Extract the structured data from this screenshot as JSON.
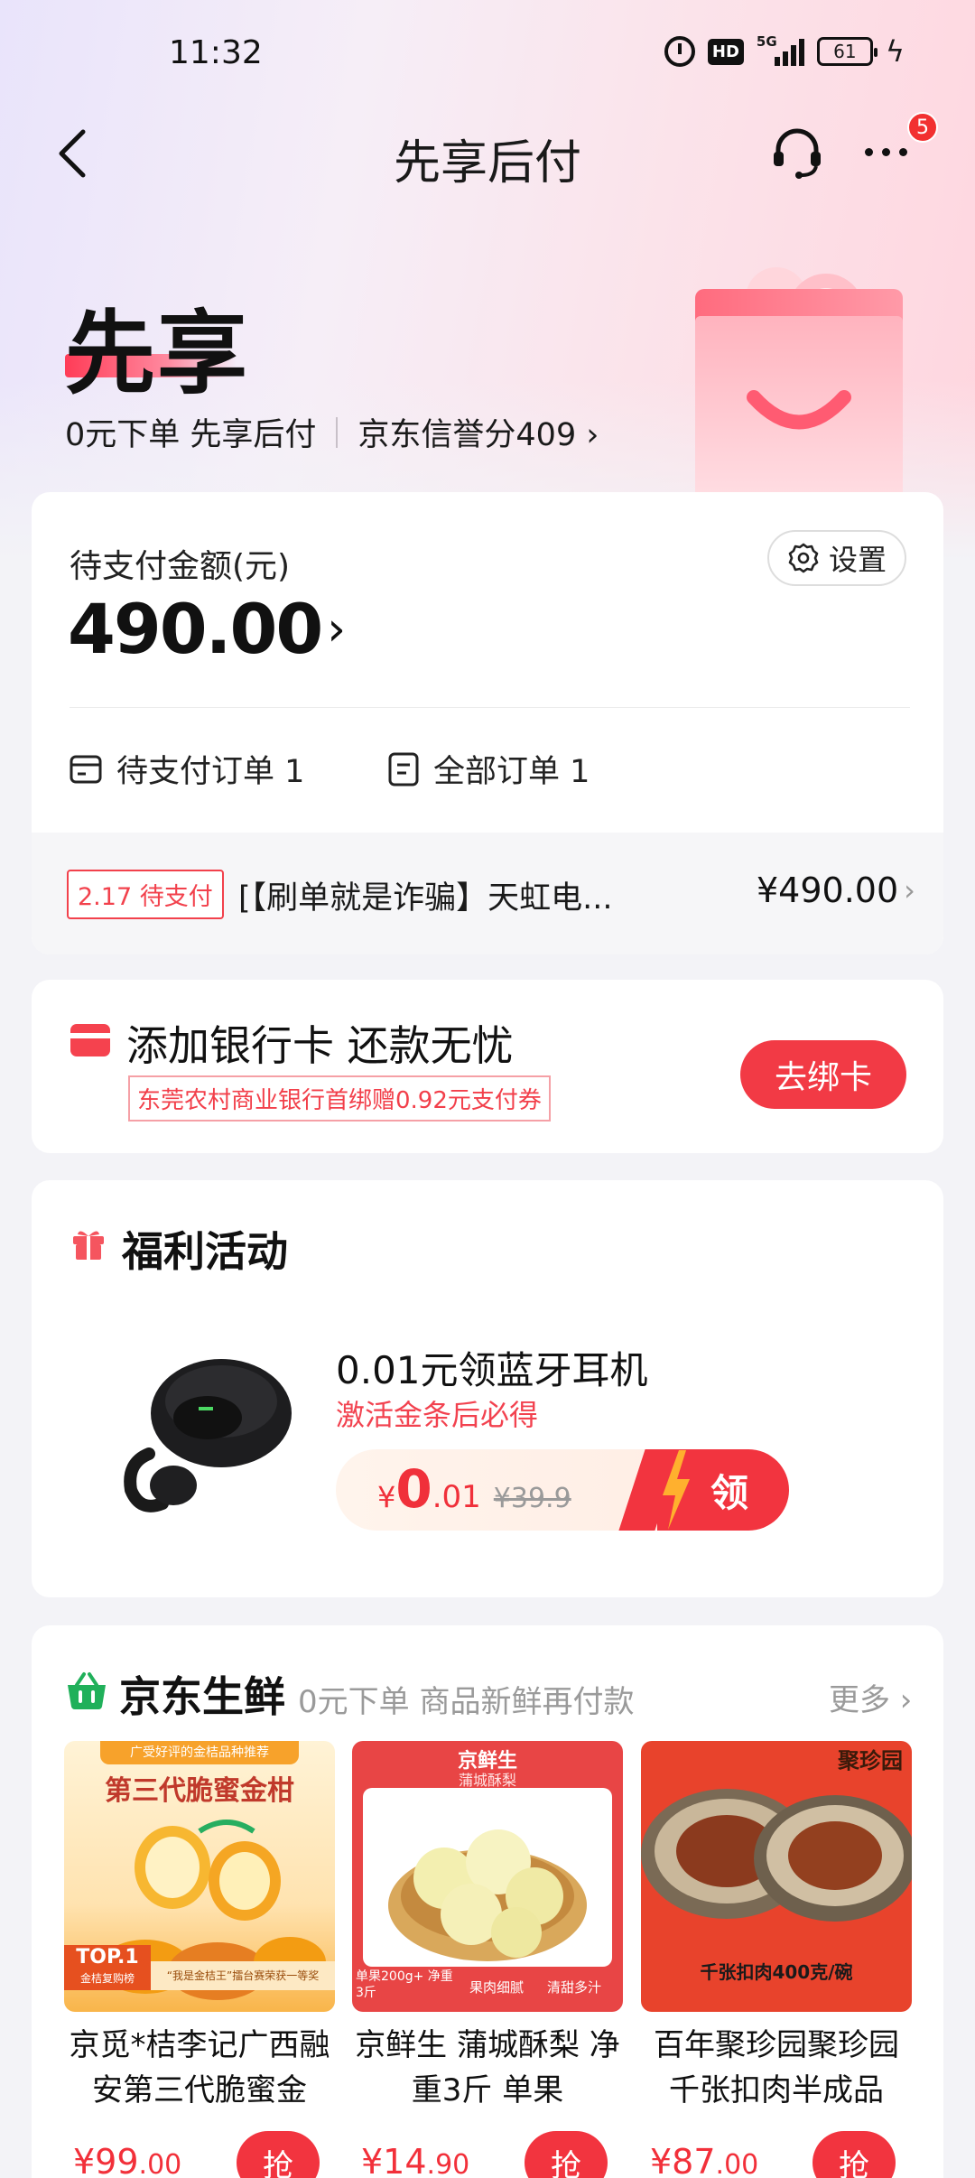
{
  "status_bar": {
    "time": "11:32",
    "hd": "HD",
    "network": "5G",
    "battery": "61"
  },
  "nav": {
    "title": "先享后付",
    "badge": "5"
  },
  "hero": {
    "title": "先享",
    "subtitle": "0元下单 先享后付",
    "credit": "京东信誉分409 ›"
  },
  "pending": {
    "label": "待支付金额(元)",
    "amount": "490.00",
    "settings_label": "设置",
    "pending_orders": "待支付订单 1",
    "all_orders": "全部订单 1",
    "order": {
      "tag": "2.17 待支付",
      "title": "[【刷单就是诈骗】天虹电...",
      "price": "¥490.00"
    }
  },
  "bank": {
    "title": "添加银行卡 还款无忧",
    "coupon": "东莞农村商业银行首绑赠0.92元支付券",
    "button": "去绑卡"
  },
  "welfare": {
    "title": "福利活动",
    "item_name": "0.01元领蓝牙耳机",
    "item_desc": "激活金条后必得",
    "currency": "¥",
    "price_int": "0",
    "price_dec": ".01",
    "original_price": "¥39.9",
    "claim": "领"
  },
  "fresh": {
    "title": "京东生鲜",
    "subtitle": "0元下单 商品新鲜再付款",
    "more": "更多 ›",
    "buy_label": "抢",
    "products": [
      {
        "name": "京觅*桔李记广西融安第三代脆蜜金桔...",
        "price_int": "¥99",
        "price_dec": ".00",
        "img_title": "第三代脆蜜金柑",
        "img_banner": "广受好评的金桔品种推荐",
        "img_badge": "TOP.1",
        "img_badge_sub": "金桔复购榜",
        "img_footer": "“我是金桔王”擂台赛荣获一等奖"
      },
      {
        "name": "京鲜生 蒲城酥梨 净重3斤 单果200g+...",
        "price_int": "¥14",
        "price_dec": ".90",
        "img_brand": "京鲜生",
        "img_title": "蒲城酥梨",
        "img_tag1": "单果200g+ 净重3斤",
        "img_tag2": "果肉细腻",
        "img_tag3": "清甜多汁"
      },
      {
        "name": "百年聚珍园聚珍园千张扣肉半成品菜...",
        "price_int": "¥87",
        "price_dec": ".00",
        "img_brand": "聚珍园",
        "img_caption": "千张扣肉400克/碗"
      }
    ]
  },
  "colors": {
    "accent": "#f2343f",
    "price": "#f2303a",
    "bg": "#f3f3f7"
  }
}
